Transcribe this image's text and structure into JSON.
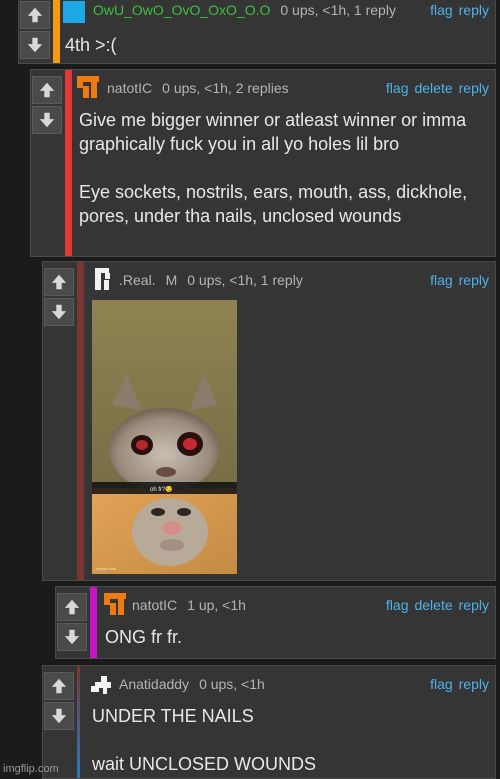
{
  "colors": {
    "panel": "#353535",
    "link": "#4fb3ea",
    "bar_orange": "#f59a12",
    "bar_red": "#e23838",
    "bar_maroon": "#7a3535",
    "bar_magenta": "#c416c4",
    "bar_blue": "#2a7bbf"
  },
  "comments": [
    {
      "username": "OwU_OwO_OvO_OxO_O.O",
      "stats": "0 ups, <1h, 1 reply",
      "actions": [
        "flag",
        "reply"
      ],
      "text": "4th >:(",
      "avatar_icon": "blue-square-avatar"
    },
    {
      "username": "natotIC",
      "stats": "0 ups, <1h, 2 replies",
      "actions": [
        "flag",
        "delete",
        "reply"
      ],
      "text": "Give me bigger winner or atleast winner or imma graphically fuck you in all yo holes lil bro\n\nEye sockets, nostrils, ears, mouth, ass, dickhole, pores, under tha nails, unclosed wounds",
      "avatar_icon": "orange-pixel-avatar"
    },
    {
      "username": ".Real.",
      "badge": "M",
      "stats": "0 ups, <1h, 1 reply",
      "actions": [
        "flag",
        "reply"
      ],
      "image_caption": "oh fr?😏",
      "image_watermark": "imgflip.com",
      "avatar_icon": "white-pixel-avatar"
    },
    {
      "username": "natotIC",
      "stats": "1 up, <1h",
      "actions": [
        "flag",
        "delete",
        "reply"
      ],
      "text": "ONG fr fr.",
      "avatar_icon": "orange-pixel-avatar"
    },
    {
      "username": "Anatidaddy",
      "stats": "0 ups, <1h",
      "actions": [
        "flag",
        "reply"
      ],
      "text": "UNDER THE NAILS\n\nwait UNCLOSED WOUNDS",
      "avatar_icon": "white-pixel-avatar"
    }
  ],
  "footer": {
    "watermark": "imgflip.com"
  }
}
